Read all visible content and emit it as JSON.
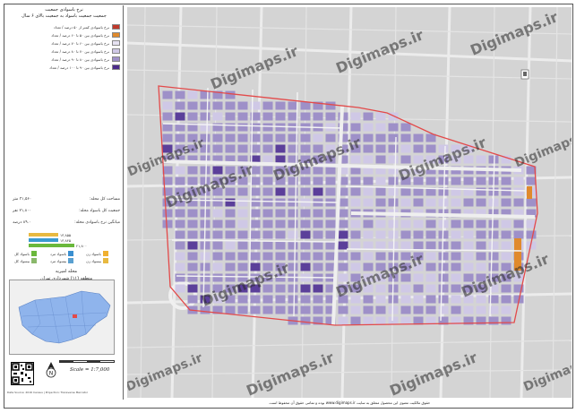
{
  "legend": {
    "title_line1": "نرخ باسوادی جمعیت",
    "title_line2": "جمعیت جمعیت باسواد به جمعیت بالای ۶ سال",
    "items": [
      {
        "label": "نرخ باسوادی کمتر از ۵۰ درصد / تعداد",
        "color": "#c0392b"
      },
      {
        "label": "نرخ باسوادی بین ۵۰ تا ۶۰ درصد / تعداد",
        "color": "#e08a2c"
      },
      {
        "label": "نرخ باسوادی بین ۶۰ تا ۷۰ درصد / تعداد",
        "color": "#e6e2f2"
      },
      {
        "label": "نرخ باسوادی بین ۷۰ تا ۸۰ درصد / تعداد",
        "color": "#cfc8e6"
      },
      {
        "label": "نرخ باسوادی بین ۸۰ تا ۹۰ درصد / تعداد",
        "color": "#9e90c8"
      },
      {
        "label": "نرخ باسوادی بین ۹۰ تا ۱۰۰ درصد / تعداد",
        "color": "#4b2b8a"
      }
    ]
  },
  "stats": {
    "total_area": "مساحت کل محله:",
    "total_area_val": "۳۱,۵۶۰ متر",
    "population_label": "جمعیت کل باسواد محله:",
    "population_val": "۲۱,۸۰۰ نفر",
    "rate_label": "میانگین نرخ باسوادی محله:",
    "rate_val": "۸۹.۰ درصد"
  },
  "bars": [
    {
      "label": "۱۳,۸۵۵",
      "color": "#e8b940",
      "fraction": 0.55
    },
    {
      "label": "۱۳,۸۴۵",
      "color": "#3a9ad0",
      "fraction": 0.55
    },
    {
      "label": "۲۱,۸۰۰",
      "color": "#6ab83b",
      "fraction": 0.85
    }
  ],
  "categories": [
    {
      "label": "باسواد زن",
      "color": "#f0b030"
    },
    {
      "label": "باسواد مرد",
      "color": "#3a8fd0"
    },
    {
      "label": "باسواد کل",
      "color": "#6ab83b"
    },
    {
      "label": "بیسواد زن",
      "color": "#e8b940"
    },
    {
      "label": "بیسواد مرد",
      "color": "#5aa0d0"
    },
    {
      "label": "بیسواد کل",
      "color": "#8ab86b"
    }
  ],
  "district": {
    "line1": "محله امیریه",
    "line2": "منطقه (۱۱) شهرداری تهران"
  },
  "scale": {
    "text": "Scale = 1:7,000"
  },
  "footer_left": "Data Source: 2016 Census | Projection: Transverse Mercator",
  "map_footer": "حقوق مالکیت معنوی این محصول متعلق به سایت www.digimaps.ir بوده و تمامی حقوق آن محفوظ است.",
  "watermark_text": "Digimaps.ir",
  "colors": {
    "boundary": "#e34a4a",
    "block_main": "#9e90c8",
    "block_light": "#cfc8e6",
    "block_dark": "#5b3f9a",
    "block_orange": "#e08a2c",
    "map_bg": "#d6d6d6"
  }
}
